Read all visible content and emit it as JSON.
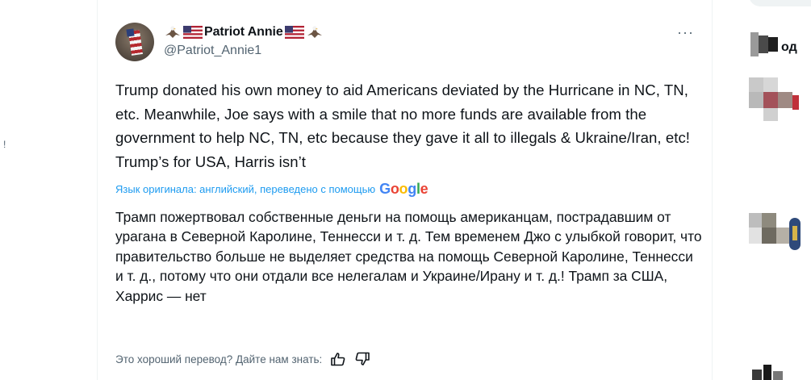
{
  "tweet": {
    "display_name": "Patriot Annie",
    "handle": "@Patriot_Annie1",
    "more_label": "···",
    "text_original": "Trump donated his own money to aid Americans deviated by the Hurricane in NC, TN, etc. Meanwhile, Joe says with a smile that no more funds are available from the government to help NC, TN, etc because they gave it all to illegals & Ukraine/Iran, etc! Trump’s for USA, Harris isn’t",
    "translation_note": "Язык оригинала: английский, переведено с помощью",
    "translation_provider": "Google",
    "text_translated": "Трамп пожертвовал собственные деньги на помощь американцам, пострадавшим от урагана в Северной Каролине, Теннесси и т. д. Тем временем Джо с улыбкой говорит, что правительство больше не выделяет средства на помощь Северной Каролине, Теннесси и т. д., потому что они отдали все нелегалам и Украине/Ирану и т. д.! Трамп за США, Харрис — нет",
    "feedback_prompt": "Это хороший перевод? Дайте нам знать:"
  },
  "left_gutter": {
    "mark": "!"
  },
  "right_panel": {
    "clipped_label": "од"
  },
  "icons": [
    "eagle-icon",
    "us-flag-icon",
    "more-icon",
    "thumbs-up-icon",
    "thumbs-down-icon"
  ],
  "colors": {
    "link": "#1d9bf0",
    "secondary_text": "#536471",
    "text": "#0f1419"
  }
}
